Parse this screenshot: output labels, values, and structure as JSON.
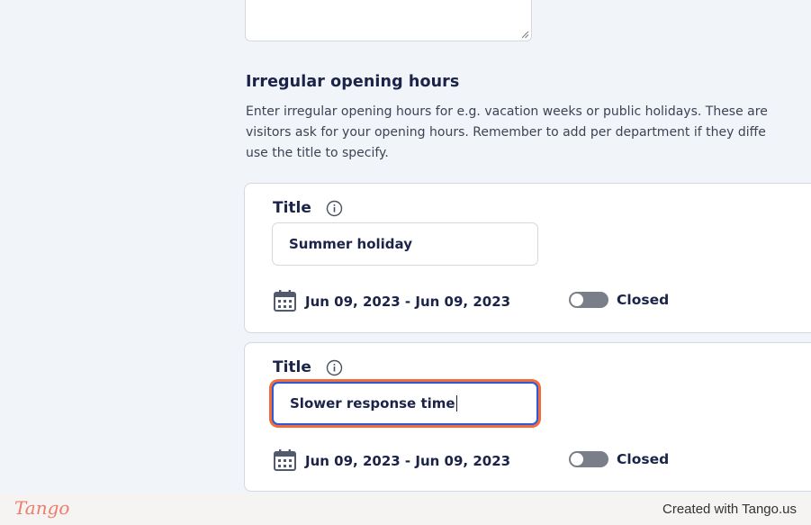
{
  "section": {
    "title": "Irregular opening hours",
    "description": "Enter irregular opening hours for e.g. vacation weeks or public holidays. These are\nvisitors ask for your opening hours. Remember to add per department if they diffe\nuse the title to specify."
  },
  "entries": [
    {
      "field_label": "Title",
      "title_value": "Summer holiday",
      "date_range": "Jun 09, 2023 - Jun 09, 2023",
      "status_label": "Closed",
      "status_on": false
    },
    {
      "field_label": "Title",
      "title_value": "Slower response time",
      "date_range": "Jun 09, 2023 - Jun 09, 2023",
      "status_label": "Closed",
      "status_on": false
    }
  ],
  "footer": {
    "logo": "Tango",
    "created_with": "Created with Tango.us"
  },
  "colors": {
    "highlight": "#f26b3a",
    "focus": "#2d5bd7",
    "text": "#1b2448",
    "brand": "#ef7c69"
  },
  "icons": [
    "resize-grip-icon",
    "info-icon",
    "calendar-icon"
  ]
}
